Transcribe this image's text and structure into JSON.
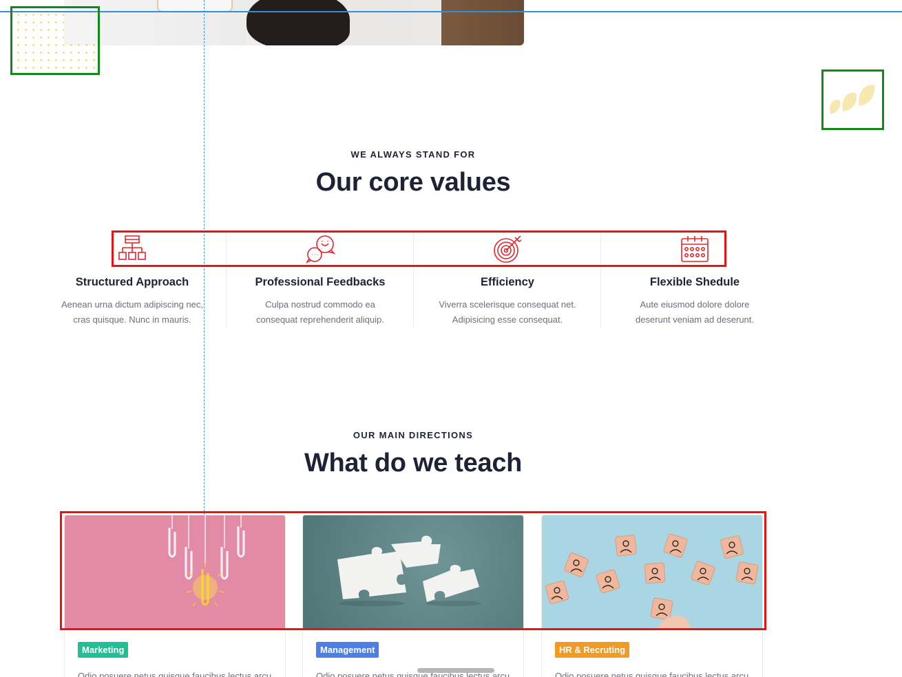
{
  "values_section": {
    "eyebrow": "WE ALWAYS STAND FOR",
    "title": "Our core values",
    "items": [
      {
        "icon": "sitemap-icon",
        "title": "Structured Approach",
        "desc": "Aenean urna dictum adipiscing nec, cras quisque. Nunc in mauris."
      },
      {
        "icon": "chat-bubbles-icon",
        "title": "Professional Feedbacks",
        "desc": "Culpa nostrud commodo ea consequat reprehenderit aliquip."
      },
      {
        "icon": "target-icon",
        "title": "Efficiency",
        "desc": "Viverra scelerisque consequat net. Adipisicing esse consequat."
      },
      {
        "icon": "calendar-icon",
        "title": "Flexible Shedule",
        "desc": "Aute eiusmod dolore dolore deserunt veniam ad deserunt."
      }
    ]
  },
  "teach_section": {
    "eyebrow": "OUR MAIN DIRECTIONS",
    "title": "What do we teach",
    "cards": [
      {
        "tag": "Marketing",
        "tag_color": "#1fc094",
        "desc": "Odio posuere netus quisque faucibus lectus arcu"
      },
      {
        "tag": "Management",
        "tag_color": "#4b7fe6",
        "desc": "Odio posuere netus quisque faucibus lectus arcu"
      },
      {
        "tag": "HR & Recruting",
        "tag_color": "#f29b24",
        "desc": "Odio posuere netus quisque faucibus lectus arcu"
      }
    ]
  },
  "colors": {
    "accent_red": "#e3262d",
    "heading": "#1e2235",
    "body_text": "#6d6f7a",
    "dot_yellow": "#f3c94b"
  }
}
